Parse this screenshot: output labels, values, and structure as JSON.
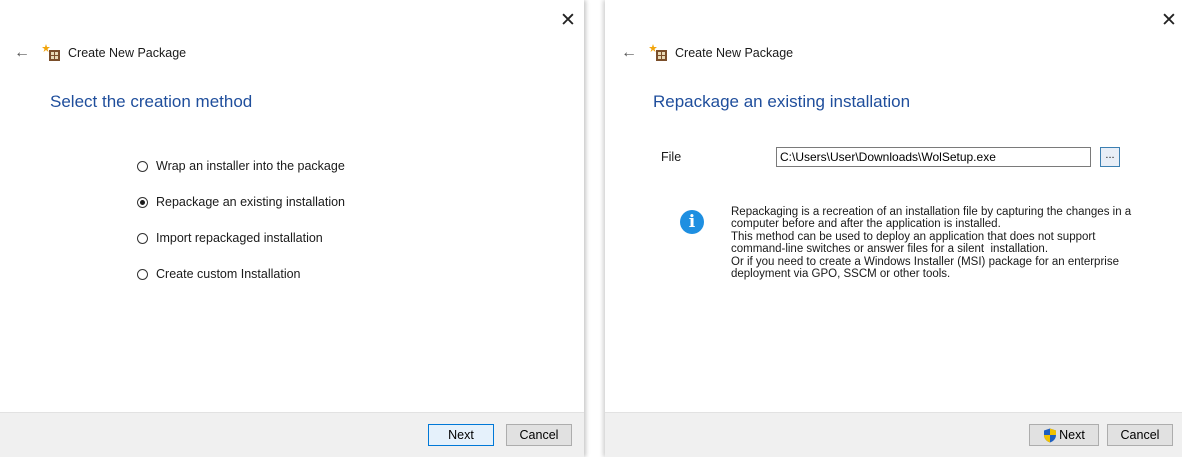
{
  "dialog1": {
    "close_glyph": "✕",
    "back_glyph": "←",
    "title": "Create New Package",
    "heading": "Select the creation method",
    "options": [
      {
        "label": "Wrap an installer into the package",
        "checked": false
      },
      {
        "label": "Repackage an existing installation",
        "checked": true
      },
      {
        "label": "Import repackaged installation",
        "checked": false
      },
      {
        "label": "Create custom Installation",
        "checked": false
      }
    ],
    "next_label": "Next",
    "cancel_label": "Cancel"
  },
  "dialog2": {
    "close_glyph": "✕",
    "back_glyph": "←",
    "title": "Create New Package",
    "heading": "Repackage an existing installation",
    "file_label": "File",
    "file_value": "C:\\Users\\User\\Downloads\\WolSetup.exe",
    "browse_label": "...",
    "info_icon_glyph": "i",
    "info_lines": [
      "Repackaging is a recreation of an installation file by capturing the changes in a",
      "computer before and after the application is installed.",
      "This method can be used to deploy an application that does not support",
      "command-line switches or answer files for a silent  installation.",
      "Or if you need to create a Windows Installer (MSI) package for an enterprise",
      "deployment via GPO, SSCM or other tools."
    ],
    "next_label": "Next",
    "cancel_label": "Cancel"
  },
  "colors": {
    "heading": "#1f4e9c",
    "info_icon": "#1e8fe1",
    "default_button_border": "#0078d7",
    "footer_bg": "#f0f0f0"
  },
  "icons": {
    "app": "package-star-icon",
    "shield": "uac-shield-icon"
  }
}
